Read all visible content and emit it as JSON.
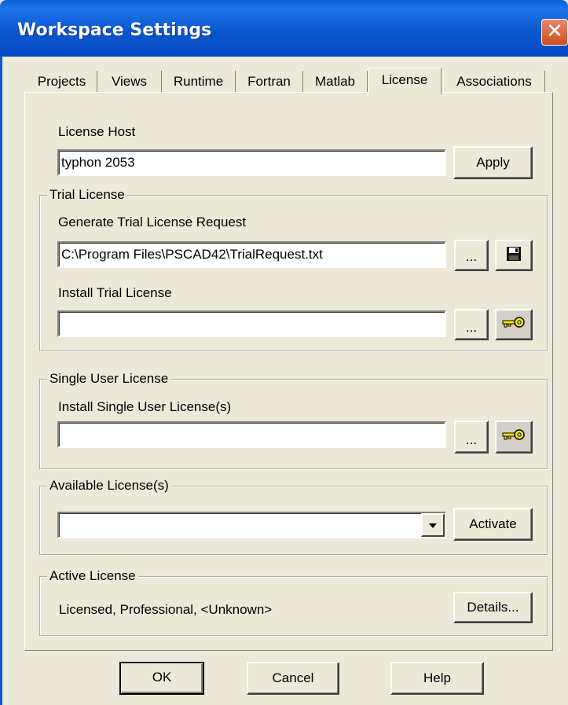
{
  "window": {
    "title": "Workspace Settings"
  },
  "tabs": [
    "Projects",
    "Views",
    "Runtime",
    "Fortran",
    "Matlab",
    "License",
    "Associations"
  ],
  "active_tab": "License",
  "license_host": {
    "label": "License Host",
    "value": "typhon 2053",
    "apply_label": "Apply"
  },
  "trial_license": {
    "legend": "Trial License",
    "generate_label": "Generate Trial License Request",
    "generate_path": "C:\\Program Files\\PSCAD42\\TrialRequest.txt",
    "install_label": "Install Trial License",
    "install_path": "",
    "browse_label": "..."
  },
  "single_user": {
    "legend": "Single User License",
    "install_label": "Install Single User License(s)",
    "install_path": "",
    "browse_label": "..."
  },
  "available": {
    "legend": "Available License(s)",
    "selected": "",
    "activate_label": "Activate"
  },
  "active": {
    "legend": "Active License",
    "status": "Licensed,  Professional,  <Unknown>",
    "details_label": "Details..."
  },
  "footer": {
    "ok_label": "OK",
    "cancel_label": "Cancel",
    "help_label": "Help"
  },
  "icons": {
    "save": "floppy-disk-icon",
    "key": "key-icon",
    "dropdown": "chevron-down-icon",
    "close": "close-icon"
  },
  "colors": {
    "titlebar": "#0b57d0",
    "window_bg": "#ece9d8",
    "close_button": "#d0501e",
    "key": "#ffee00"
  }
}
